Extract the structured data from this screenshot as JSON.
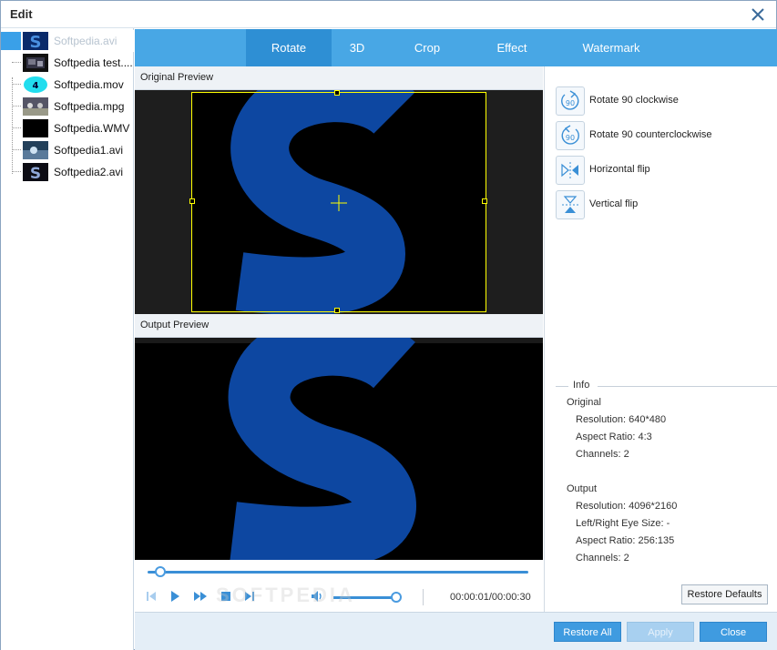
{
  "window": {
    "title": "Edit"
  },
  "files": [
    {
      "name": "Softpedia.avi",
      "selected": true
    },
    {
      "name": "Softpedia test...."
    },
    {
      "name": "Softpedia.mov"
    },
    {
      "name": "Softpedia.mpg"
    },
    {
      "name": "Softpedia.WMV"
    },
    {
      "name": "Softpedia1.avi"
    },
    {
      "name": "Softpedia2.avi"
    }
  ],
  "tabs": [
    {
      "label": "Rotate",
      "active": true
    },
    {
      "label": "3D"
    },
    {
      "label": "Crop"
    },
    {
      "label": "Effect"
    },
    {
      "label": "Watermark"
    }
  ],
  "preview": {
    "original_label": "Original Preview",
    "output_label": "Output Preview"
  },
  "playback": {
    "timecode": "00:00:01/00:00:30",
    "progress_fraction": 0.033,
    "volume_fraction": 1.0,
    "watermark": "SOFTPEDIA"
  },
  "actions": [
    {
      "label": "Rotate 90 clockwise",
      "icon": "rotate-cw-icon"
    },
    {
      "label": "Rotate 90 counterclockwise",
      "icon": "rotate-ccw-icon"
    },
    {
      "label": "Horizontal flip",
      "icon": "horizontal-flip-icon"
    },
    {
      "label": "Vertical flip",
      "icon": "vertical-flip-icon"
    }
  ],
  "icon_text": {
    "rotate": "90"
  },
  "info": {
    "heading": "Info",
    "original_heading": "Original",
    "original_resolution": "Resolution: 640*480",
    "original_aspect": "Aspect Ratio: 4:3",
    "original_channels": "Channels: 2",
    "output_heading": "Output",
    "output_resolution": "Resolution: 4096*2160",
    "output_eye": "Left/Right Eye Size: -",
    "output_aspect": "Aspect Ratio: 256:135",
    "output_channels": "Channels: 2"
  },
  "buttons": {
    "restore_defaults": "Restore Defaults",
    "restore_all": "Restore All",
    "apply": "Apply",
    "close": "Close"
  },
  "colors": {
    "accent": "#48a7e5",
    "tab_active": "#2e8fd4",
    "logo_blue": "#0d47a1",
    "crop_yellow": "#ffff00"
  }
}
